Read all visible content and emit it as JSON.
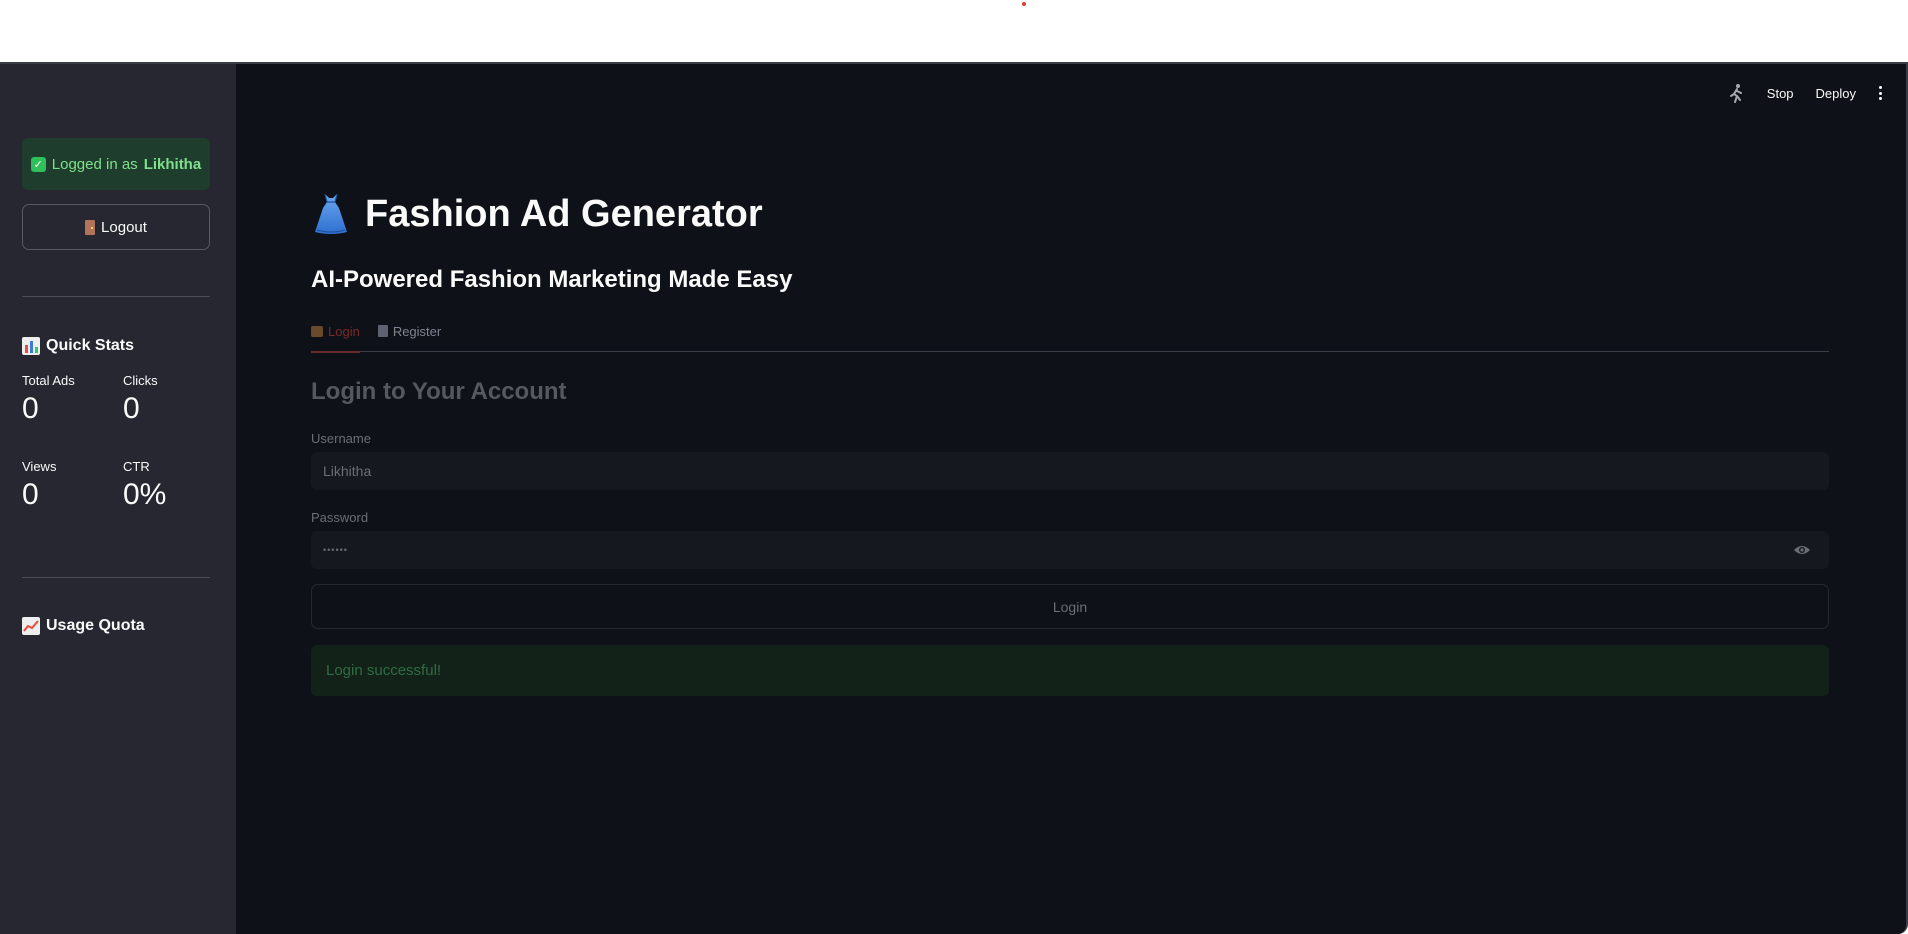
{
  "sidebar": {
    "login_prefix": "Logged in as",
    "login_user": "Likhitha",
    "logout_label": "Logout",
    "quick_stats_title": "Quick Stats",
    "stats": [
      {
        "label": "Total Ads",
        "value": "0"
      },
      {
        "label": "Clicks",
        "value": "0"
      },
      {
        "label": "Views",
        "value": "0"
      },
      {
        "label": "CTR",
        "value": "0%"
      }
    ],
    "usage_quota_title": "Usage Quota"
  },
  "header": {
    "stop_label": "Stop",
    "deploy_label": "Deploy"
  },
  "main": {
    "title": "Fashion Ad Generator",
    "subtitle": "AI-Powered Fashion Marketing Made Easy",
    "tabs": [
      {
        "label": "Login",
        "active": true
      },
      {
        "label": "Register",
        "active": false
      }
    ],
    "form_heading": "Login to Your Account",
    "username_label": "Username",
    "username_value": "Likhitha",
    "password_label": "Password",
    "password_value": "••••••",
    "login_button": "Login",
    "success_message": "Login successful!"
  },
  "colors": {
    "app_bg": "#0e1117",
    "sidebar_bg": "#262730",
    "success_green": "#7ee08c",
    "accent_red": "#ff4b4b"
  }
}
